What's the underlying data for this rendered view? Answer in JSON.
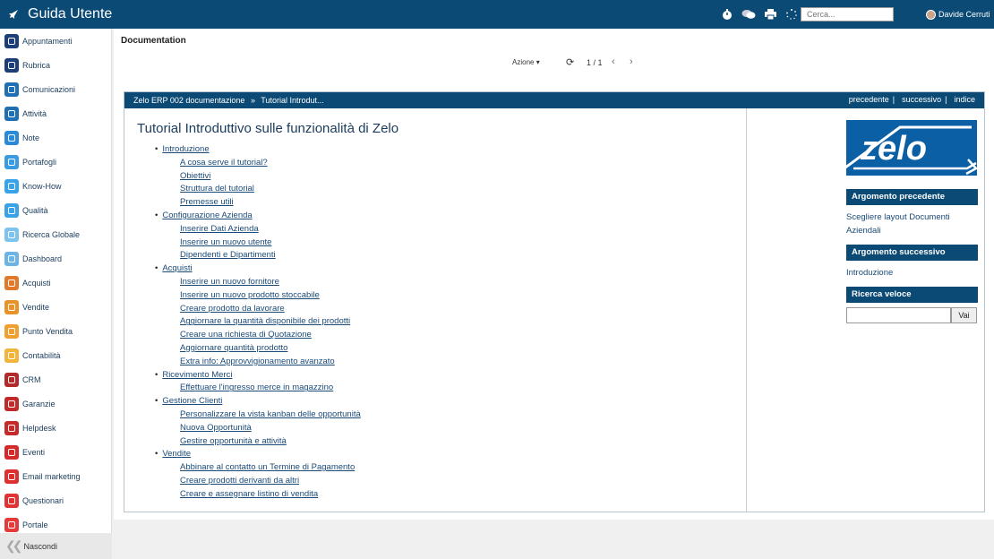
{
  "app": {
    "title": "Guida Utente"
  },
  "topbar": {
    "search_placeholder": "Cerca...",
    "user_name": "Davide Cerruti"
  },
  "sidebar": {
    "items": [
      {
        "label": "Appuntamenti",
        "color": "#1c3f7a"
      },
      {
        "label": "Rubrica",
        "color": "#1c3f7a"
      },
      {
        "label": "Comunicazioni",
        "color": "#1f6fb5"
      },
      {
        "label": "Attività",
        "color": "#1f6fb5"
      },
      {
        "label": "Note",
        "color": "#2a8ad8"
      },
      {
        "label": "Portafogli",
        "color": "#3a9be0"
      },
      {
        "label": "Know-How",
        "color": "#3aa3e8"
      },
      {
        "label": "Qualità",
        "color": "#3aa3e8"
      },
      {
        "label": "Ricerca Globale",
        "color": "#7ec2ee"
      },
      {
        "label": "Dashboard",
        "color": "#6cb4e6"
      },
      {
        "label": "Acquisti",
        "color": "#e07a2a"
      },
      {
        "label": "Vendite",
        "color": "#e8922a"
      },
      {
        "label": "Punto Vendita",
        "color": "#f0a030"
      },
      {
        "label": "Contabilità",
        "color": "#f2b43a"
      },
      {
        "label": "CRM",
        "color": "#b22a2a"
      },
      {
        "label": "Garanzie",
        "color": "#c02a2a"
      },
      {
        "label": "Helpdesk",
        "color": "#c62a2a"
      },
      {
        "label": "Eventi",
        "color": "#d42a2a"
      },
      {
        "label": "Email marketing",
        "color": "#dd2f2f"
      },
      {
        "label": "Questionari",
        "color": "#e03434"
      },
      {
        "label": "Portale",
        "color": "#e43a3a"
      }
    ],
    "footer_label": "Nascondi"
  },
  "main": {
    "title": "Documentation",
    "toolbar": {
      "azione": "Azione",
      "pager": "1 / 1"
    }
  },
  "doc": {
    "crumb_root": "Zelo ERP 002 documentazione",
    "crumb_current": "Tutorial Introdut...",
    "nav": {
      "prev": "precedente",
      "next": "successivo",
      "index": "indice"
    },
    "heading": "Tutorial Introduttivo sulle funzionalità di Zelo",
    "toc": [
      {
        "label": "Introduzione",
        "children": [
          "A cosa serve il tutorial?",
          "Obiettivi",
          "Struttura del tutorial",
          "Premesse utili"
        ]
      },
      {
        "label": "Configurazione Azienda",
        "children": [
          "Inserire Dati Azienda",
          "Inserire un nuovo utente",
          "Dipendenti e Dipartimenti"
        ]
      },
      {
        "label": "Acquisti",
        "children": [
          "Inserire un nuovo fornitore",
          "Inserire un nuovo prodotto stoccabile",
          "Creare prodotto da lavorare",
          "Aggiornare la quantità disponibile dei prodotti",
          "Creare una richiesta di Quotazione",
          "Aggiornare quantità prodotto",
          "Extra info: Approvvigionamento avanzato"
        ]
      },
      {
        "label": "Ricevimento Merci",
        "children": [
          "Effettuare l'ingresso merce in magazzino"
        ]
      },
      {
        "label": "Gestione Clienti",
        "children": [
          "Personalizzare la vista kanban delle opportunità",
          "Nuova Opportunità",
          "Gestire opportunità e attività"
        ]
      },
      {
        "label": "Vendite",
        "children": [
          "Abbinare al contatto un Termine di Pagamento",
          "Creare prodotti derivanti da altri",
          "Creare e assegnare listino di vendita"
        ]
      }
    ],
    "side": {
      "logo_text": "zelo",
      "prev_topic_title": "Argomento precedente",
      "prev_topic_link": "Scegliere layout Documenti Aziendali",
      "next_topic_title": "Argomento successivo",
      "next_topic_link": "Introduzione",
      "quick_search_title": "Ricerca veloce",
      "quick_search_button": "Vai"
    }
  }
}
